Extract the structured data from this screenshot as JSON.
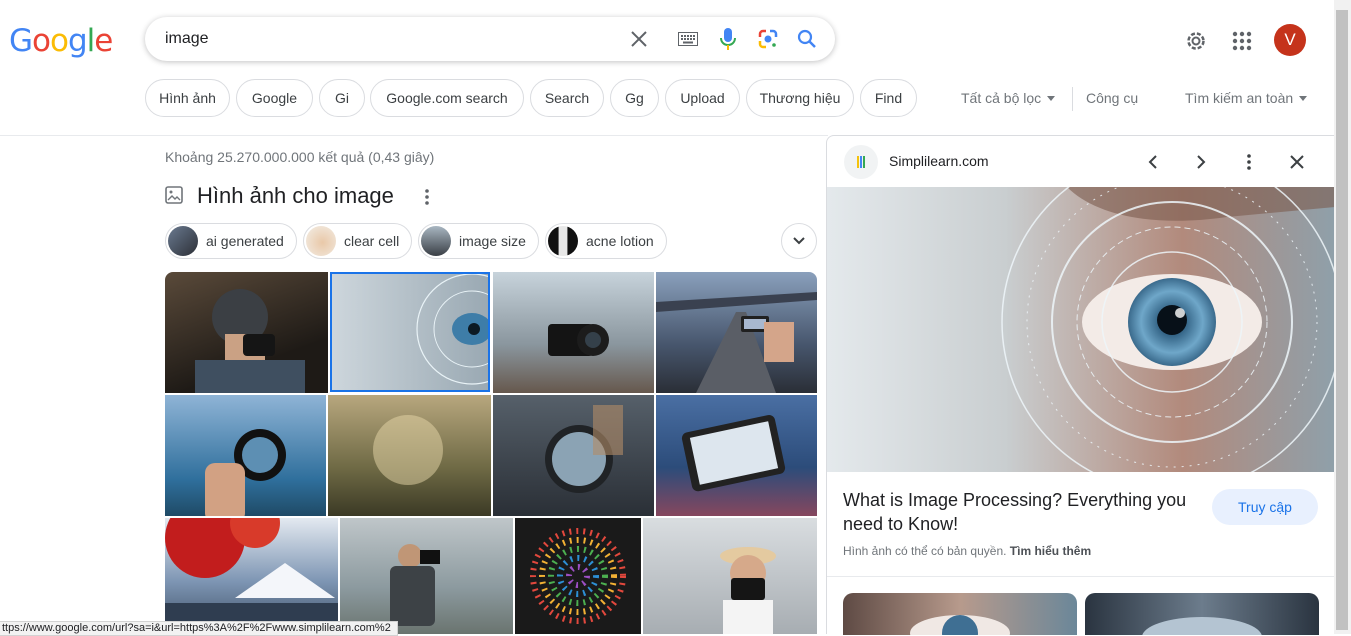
{
  "header": {
    "logo_letters": [
      "G",
      "o",
      "o",
      "g",
      "l",
      "e"
    ],
    "search_value": "image",
    "icons": [
      "clear-icon",
      "keyboard-icon",
      "mic-icon",
      "lens-icon",
      "search-icon"
    ],
    "avatar_letter": "V"
  },
  "chips": [
    "Hình ảnh",
    "Google",
    "Gi",
    "Google.com search",
    "Search",
    "Gg",
    "Upload",
    "Thương hiệu",
    "Find"
  ],
  "tools": {
    "filters": "Tất cả bộ lọc",
    "tools": "Công cụ",
    "safe_search": "Tìm kiếm an toàn"
  },
  "results": {
    "stats": "Khoảng 25.270.000.000 kết quả (0,43 giây)",
    "image_section_title": "Hình ảnh cho image",
    "related_chips": [
      "ai generated",
      "clear cell",
      "image size",
      "acne lotion"
    ]
  },
  "panel": {
    "site": "Simplilearn.com",
    "headline": "What is Image Processing? Everything you need to Know!",
    "visit_label": "Truy cập",
    "copyright_text": "Hình ảnh có thể có bản quyền.",
    "learn_more": "Tìm hiểu thêm"
  },
  "status_url": "ttps://www.google.com/url?sa=i&url=https%3A%2F%2Fwww.simplilearn.com%2",
  "colors": {
    "accent": "#1a73e8",
    "avatar": "#c5331b",
    "chip_border": "#dadce0"
  }
}
